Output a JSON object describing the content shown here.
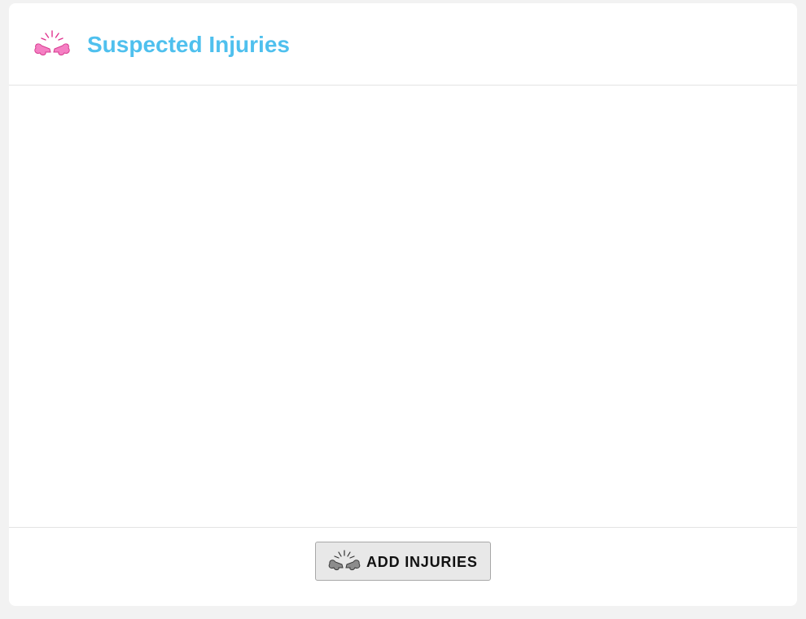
{
  "panel": {
    "title": "Suspected Injuries",
    "title_color": "#4fc0ee",
    "title_icon": "pink-bone-fracture-icon",
    "title_icon_color": "#f57fc3"
  },
  "footer": {
    "add_button_label": "ADD INJURIES",
    "add_button_icon": "grey-bone-fracture-icon",
    "add_button_icon_color": "#8c8c8c"
  }
}
